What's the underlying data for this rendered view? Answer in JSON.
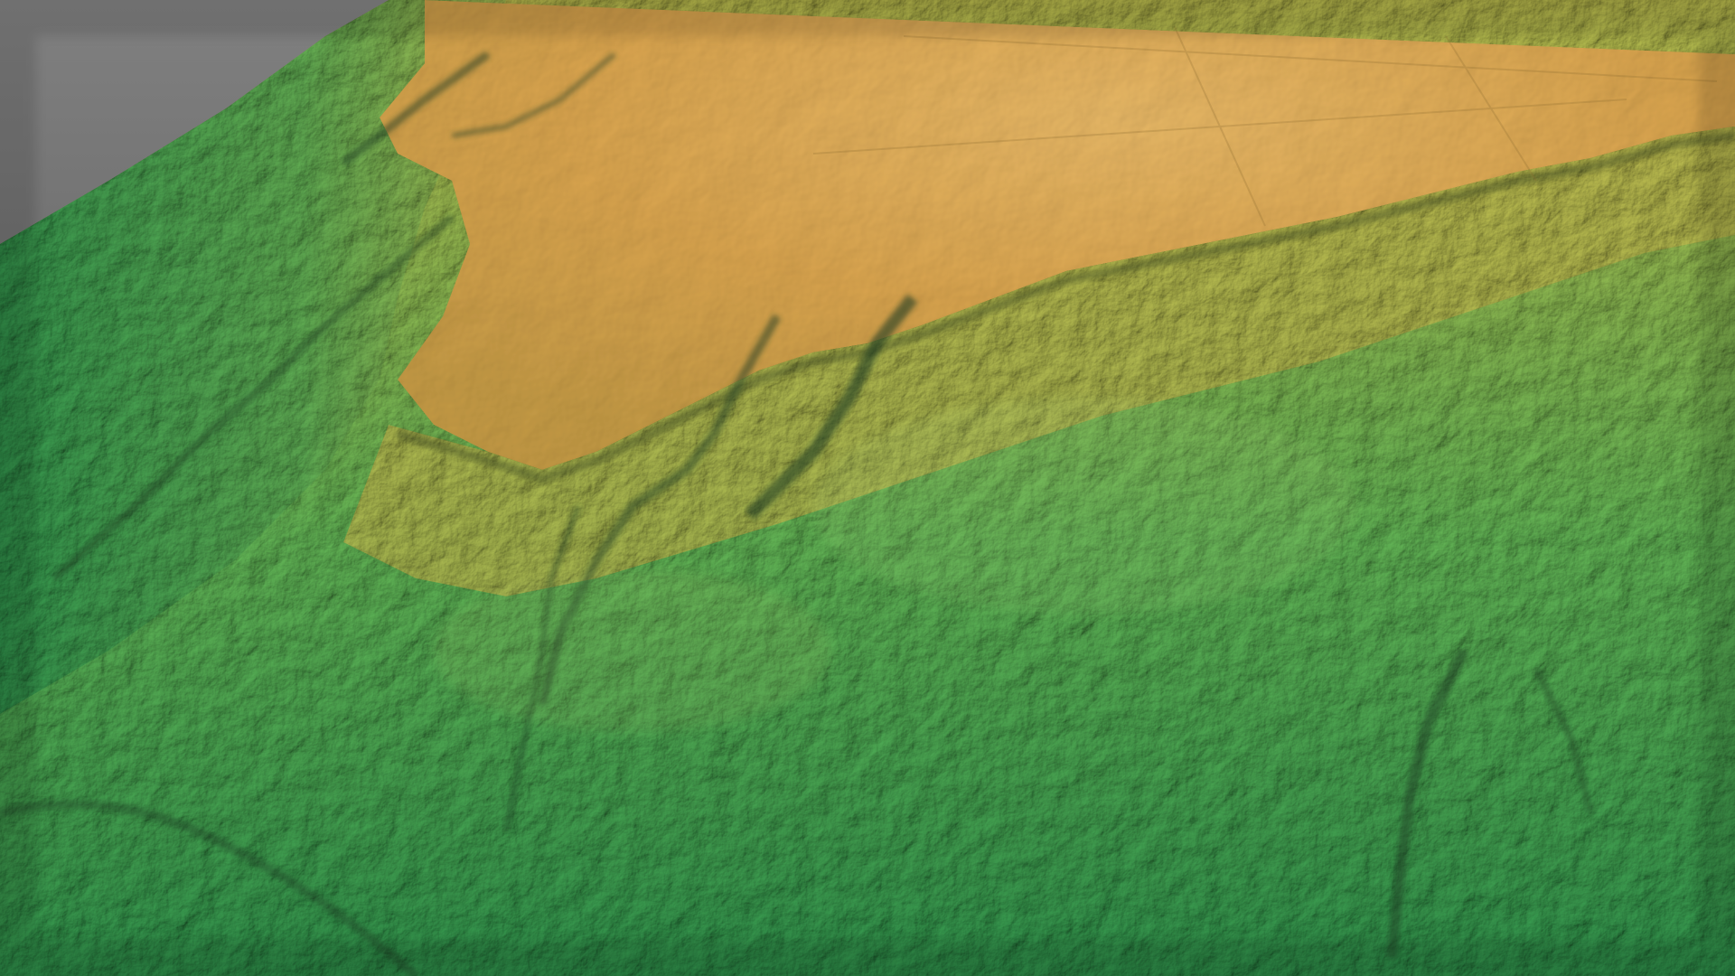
{
  "scene": {
    "description_visible_text": "",
    "colors": {
      "background_top": "#808080",
      "background_bottom": "#4a4a4a",
      "lowland": "#2f8f4a",
      "lowland_light": "#5fae52",
      "midland": "#a7b84f",
      "plateau": "#d9a44e",
      "plateau_light": "#e8b866",
      "shadow": "#1c3a22"
    },
    "elements": {
      "terrain": "terrain-surface",
      "plateau": "plateau-region",
      "escarpment": "escarpment-ridge",
      "valleys": "valley-channels"
    }
  }
}
